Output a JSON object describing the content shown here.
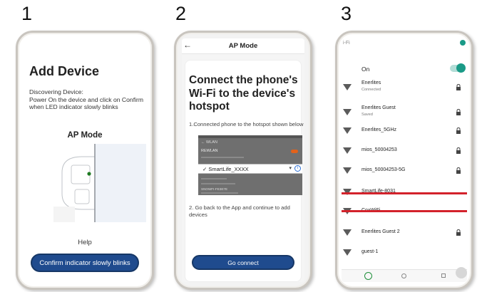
{
  "steps": [
    {
      "number": "1"
    },
    {
      "number": "2"
    },
    {
      "number": "3"
    }
  ],
  "phone1": {
    "title": "Add Device",
    "description": "Discovering Device:\nPower On the device and click on Confirm when LED indicator slowly blinks",
    "mode_label": "AP Mode",
    "help_label": "Help",
    "confirm_button": "Confirm indicator slowly blinks"
  },
  "phone2": {
    "header_title": "AP Mode",
    "title": "Connect the phone's Wi-Fi to the device's hotspot",
    "step1": "1.Connected phone to the hotspot shown below",
    "hotspot": {
      "wlan_label": "WLAN",
      "network_top": "REWLAN",
      "ssid": "SmartLife_XXXX",
      "network_bottom": "SNOWFI-FE3E7E"
    },
    "step2": "2. Go back to the App and continue to add devices",
    "connect_button": "Go connect"
  },
  "phone3": {
    "status_left": "i-Fi",
    "wifi_label": "On",
    "wifi_enabled": true,
    "networks": [
      {
        "name": "Enerlites",
        "status": "Connected",
        "locked": true
      },
      {
        "name": "Enerlites Guest",
        "status": "Saved",
        "locked": true
      },
      {
        "name": "Enerlites_5GHz",
        "status": "",
        "locked": true
      },
      {
        "name": "mios_50004253",
        "status": "",
        "locked": true
      },
      {
        "name": "mios_50004253-5G",
        "status": "",
        "locked": true
      },
      {
        "name": "SmartLife-8031",
        "status": "",
        "locked": false,
        "highlighted": true
      },
      {
        "name": "CoxWiFi",
        "status": "",
        "locked": false
      },
      {
        "name": "Enerlites Guest 2",
        "status": "",
        "locked": true
      },
      {
        "name": "guest-1",
        "status": "",
        "locked": false
      }
    ]
  },
  "colors": {
    "button_blue": "#1f4b8e",
    "highlight_red": "#d3222b",
    "toggle_teal": "#1a9a87",
    "led_green": "#1f7a22"
  }
}
